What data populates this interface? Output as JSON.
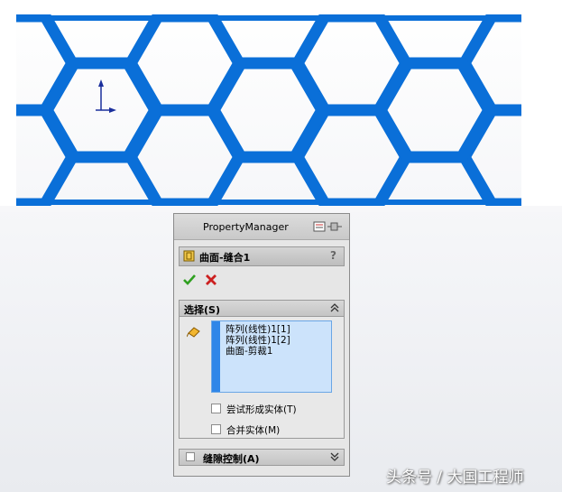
{
  "property_manager": {
    "title": "PropertyManager",
    "feature_title": "曲面-缝合1",
    "help": "?",
    "selection": {
      "header": "选择(S)",
      "items": [
        "阵列(线性)1[1]",
        "阵列(线性)1[2]",
        "曲面-剪裁1"
      ],
      "try_form_solid": "尝试形成实体(T)",
      "merge_solids": "合并实体(M)"
    },
    "gap_control": {
      "header": "缝隙控制(A)"
    }
  },
  "watermark": "头条号 / 大国工程师",
  "colors": {
    "hex_blue": "#0a6fd8",
    "list_bg": "#cce3fb",
    "ok_green": "#2fa020",
    "cancel_red": "#cc2020"
  }
}
